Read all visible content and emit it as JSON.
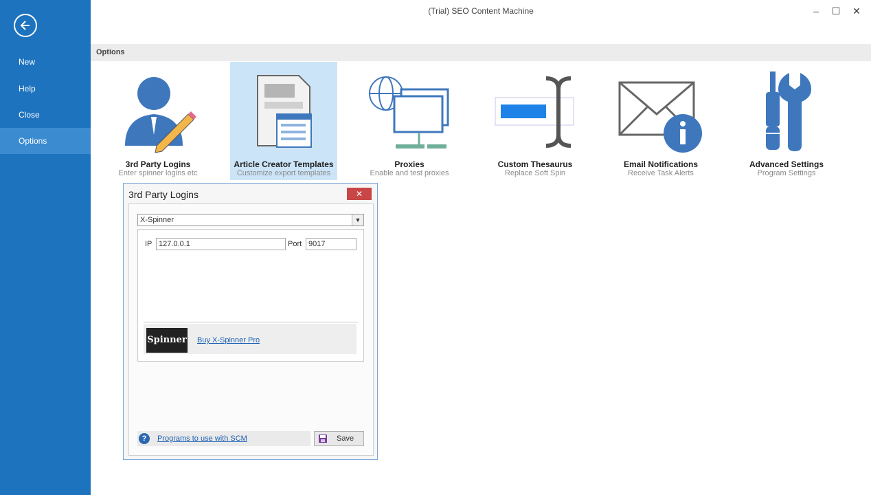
{
  "window": {
    "title": "(Trial) SEO Content Machine",
    "minimize": "–",
    "maximize": "☐",
    "close": "✕"
  },
  "sidebar": {
    "items": [
      {
        "label": "New"
      },
      {
        "label": "Help"
      },
      {
        "label": "Close"
      },
      {
        "label": "Options"
      }
    ]
  },
  "options_header": "Options",
  "tiles": [
    {
      "title": "3rd Party Logins",
      "subtitle": "Enter spinner logins etc"
    },
    {
      "title": "Article Creator Templates",
      "subtitle": "Customize export templates"
    },
    {
      "title": "Proxies",
      "subtitle": "Enable and test proxies"
    },
    {
      "title": "Custom Thesaurus",
      "subtitle": "Replace Soft Spin"
    },
    {
      "title": "Email Notifications",
      "subtitle": "Receive Task Alerts"
    },
    {
      "title": "Advanced Settings",
      "subtitle": "Program Settings"
    }
  ],
  "dialog": {
    "title": "3rd Party Logins",
    "close": "✕",
    "spinner_select": "X-Spinner",
    "ip_label": "IP",
    "ip_value": "127.0.0.1",
    "port_label": "Port",
    "port_value": "9017",
    "logo_text": "Spinner",
    "buy_link": "Buy X-Spinner Pro",
    "help_link": "Programs to use with SCM",
    "save": "Save"
  }
}
